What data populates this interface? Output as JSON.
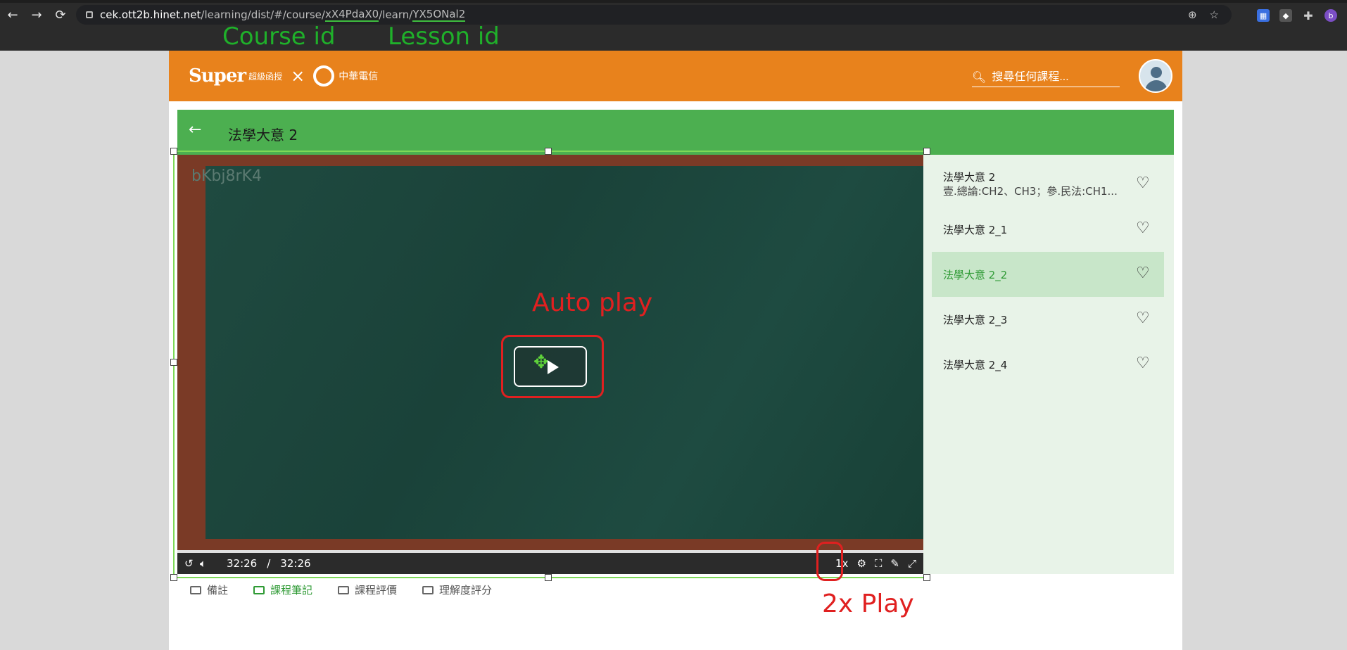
{
  "browser": {
    "url_host": "cek.ott2b.hinet.net",
    "url_path1": "/learning/dist/#/course/",
    "course_id": "xX4PdaX0",
    "url_path2": "/learn/",
    "lesson_id": "YX5ONal2",
    "profile_initial": "b"
  },
  "annotations": {
    "course_label": "Course id",
    "lesson_label": "Lesson id",
    "autoplay_label": "Auto play",
    "speed_label": "2x Play"
  },
  "header": {
    "logo_text": "Super",
    "logo_sub": "超級函授",
    "partner": "中華電信",
    "search_placeholder": "搜尋任何課程..."
  },
  "course": {
    "title": "法學大意 2"
  },
  "playlist": [
    {
      "title": "法學大意 2",
      "subtitle": "壹.總論:CH2、CH3；參.民法:CH1..."
    },
    {
      "title": "法學大意 2_1"
    },
    {
      "title": "法學大意 2_2",
      "active": true
    },
    {
      "title": "法學大意 2_3"
    },
    {
      "title": "法學大意 2_4"
    }
  ],
  "player": {
    "watermark": "bKbj8rK4",
    "current_time": "32:26",
    "separator": "/",
    "duration": "32:26",
    "speed": "1x"
  },
  "tabs": [
    "備註",
    "課程筆記",
    "課程評價",
    "理解度評分"
  ]
}
